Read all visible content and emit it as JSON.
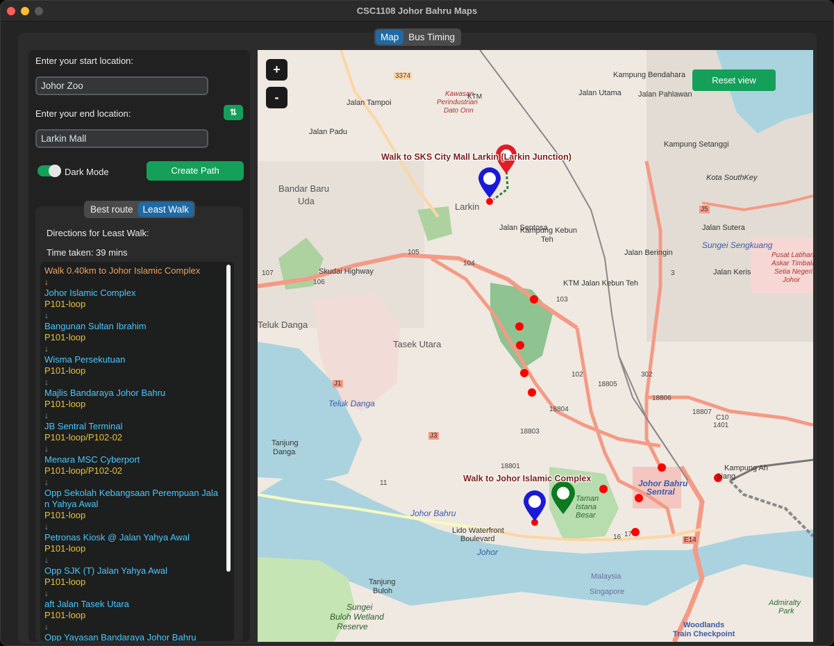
{
  "window": {
    "title": "CSC1108 Johor Bahru Maps"
  },
  "top_tabs": [
    {
      "label": "Map",
      "active": true
    },
    {
      "label": "Bus Timing",
      "active": false
    }
  ],
  "form": {
    "start_label": "Enter your start location:",
    "start_value": "Johor Zoo",
    "end_label": "Enter your end location:",
    "end_value": "Larkin Mall",
    "swap_icon": "⇅",
    "dark_mode_label": "Dark Mode",
    "dark_mode_on": true,
    "create_path_label": "Create Path"
  },
  "route_tabs": [
    {
      "label": "Best route",
      "active": false
    },
    {
      "label": "Least Walk",
      "active": true
    }
  ],
  "directions": {
    "heading": "Directions for Least Walk:",
    "time_taken": "Time taken: 39 mins",
    "walk_first": "Walk 0.40km to Johor Islamic Complex",
    "steps": [
      {
        "stop": "Johor Islamic Complex",
        "bus": "P101-loop"
      },
      {
        "stop": "Bangunan Sultan Ibrahim",
        "bus": "P101-loop"
      },
      {
        "stop": "Wisma Persekutuan",
        "bus": "P101-loop"
      },
      {
        "stop": "Majlis Bandaraya Johor Bahru",
        "bus": "P101-loop"
      },
      {
        "stop": "JB Sentral Terminal",
        "bus": "P101-loop/P102-02"
      },
      {
        "stop": "Menara MSC Cyberport",
        "bus": "P101-loop/P102-02"
      },
      {
        "stop": "Opp Sekolah Kebangsaan Perempuan Jala",
        "stop2": "n Yahya Awal",
        "bus": "P101-loop"
      },
      {
        "stop": "Petronas Kiosk @ Jalan Yahya Awal",
        "bus": "P101-loop"
      },
      {
        "stop": "Opp SJK (T) Jalan Yahya Awal",
        "bus": "P101-loop"
      },
      {
        "stop": "aft Jalan Tasek Utara",
        "bus": "P101-loop"
      },
      {
        "stop": "Opp Yayasan Bandaraya Johor Bahru",
        "bus": ""
      }
    ],
    "arrow": "↓"
  },
  "map": {
    "zoom_in": "+",
    "zoom_out": "-",
    "reset_label": "Reset view",
    "path_label_end": "Walk to SKS City Mall Larkin (Larkin Junction)",
    "path_label_start": "Walk to Johor Islamic Complex",
    "place_labels": {
      "kampung_bendahara": "Kampung Bendahara",
      "kampung_setanggi": "Kampung Setanggi",
      "bandar_baru_uda_1": "Bandar Baru",
      "bandar_baru_uda_2": "Uda",
      "larkin": "Larkin",
      "kampung_kebun_teh_1": "Kampung Kebun",
      "kampung_kebun_teh_2": "Teh",
      "teluk_danga": "Teluk Danga",
      "tasek_utara": "Tasek Utara",
      "teluk_danga_water": "Teluk Danga",
      "tanjung_danga_1": "Tanjung",
      "tanjung_danga_2": "Danga",
      "johor_bahru_sentral_1": "Johor Bahru",
      "johor_bahru_sentral_2": "Sentral",
      "kampung_ah_siang_1": "Kampung Ah",
      "kampung_ah_siang_2": "Siang",
      "taman_istana_1": "Taman",
      "taman_istana_2": "Istana",
      "taman_istana_3": "Besar",
      "lido_1": "Lido Waterfront",
      "lido_2": "Boulevard",
      "johor_bahru_coast": "Johor Bahru",
      "johor_water": "Johor",
      "malaysia": "Malaysia",
      "singapore": "Singapore",
      "tanjung_buloh_1": "Tanjung",
      "tanjung_buloh_2": "Buloh",
      "sungei_buloh_1": "Sungei",
      "sungei_buloh_2": "Buloh Wetland",
      "sungei_buloh_3": "Reserve",
      "woodlands_1": "Woodlands",
      "woodlands_2": "Train Checkpoint",
      "admiralty_1": "Admiralty",
      "admiralty_2": "Park",
      "kota_southkey": "Kota SouthKey",
      "jalan_sutera": "Jalan Sutera",
      "sungei_sengkuang": "Sungei Sengkuang",
      "jalan_keris": "Jalan Keris",
      "jalan_beringin": "Jalan Beringin",
      "jalan_tampoi": "Jalan Tampoi",
      "jalan_padu": "Jalan Padu",
      "jalan_utama": "Jalan Utama",
      "jalan_pahlawan": "Jalan Pahlawan",
      "skudai_highway": "Skudai Highway",
      "jalan_sentosa": "Jalan Sentosa",
      "jalan_kebun_teh": "KTM Jalan Kebun Teh",
      "perindustrian_1": "Kawasan",
      "perindustrian_2": "Perindustrian",
      "perindustrian_3": "Dato Onn",
      "pusat_1": "Pusat Latihan",
      "pusat_2": "Askar Timbalan",
      "pusat_3": "Setia Negeri",
      "pusat_4": "Johor",
      "ktm": "KTM"
    },
    "route_numbers": {
      "r3374": "3374",
      "r105": "105",
      "r104": "104",
      "r103": "103",
      "r102": "102",
      "r107": "107",
      "r106": "106",
      "r3": "3",
      "r302": "302",
      "r18805": "18805",
      "r18806": "18806",
      "r18807": "18807",
      "r18804": "18804",
      "r18803": "18803",
      "r18801": "18801",
      "rJ5": "J5",
      "rJ1": "J1",
      "rJ3": "J3",
      "rE14": "E14",
      "r11": "11",
      "r16": "16",
      "r17": "17",
      "rC10": "C10",
      "r1401": "1401"
    }
  }
}
